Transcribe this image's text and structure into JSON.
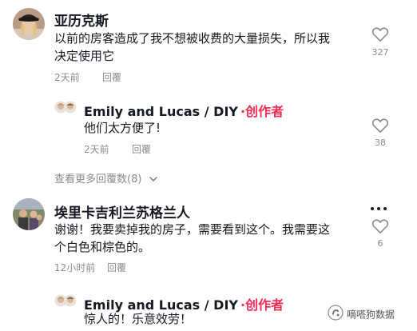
{
  "comments": [
    {
      "username": "亚历克斯",
      "text_line1": "以前的房客造成了我不想被收费的大量损失，所以我",
      "text_line2": "决定使用它",
      "time": "2天前",
      "reply_label": "回覆",
      "likes": "327",
      "reply": {
        "author": "Emily and Lucas / DIY",
        "dot": "·",
        "creator_label": "创作者",
        "text": "他们太方便了!",
        "time": "2天前",
        "reply_label": "回覆",
        "likes": "38"
      },
      "view_more": "查看更多回覆数(8)"
    },
    {
      "username": "埃里卡吉利兰苏格兰人",
      "text_line1": "谢谢！我要卖掉我的房子，需要看到这个。我需要这",
      "text_line2": "个白色和棕色的。",
      "time": "12小时前",
      "reply_label": "回覆",
      "likes": "6",
      "reply": {
        "author": "Emily and Lucas / DIY",
        "dot": "·",
        "creator_label": "创作者",
        "text": "惊人的！乐意效劳！"
      }
    }
  ],
  "watermark": "嘀嗒狗数据",
  "colors": {
    "creator": "#fe2c55",
    "secondary_text": "#8a8b91"
  }
}
